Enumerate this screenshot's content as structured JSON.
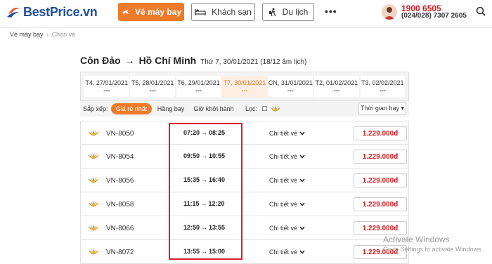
{
  "brand": {
    "name": "BestPrice",
    "suffix": ".vn"
  },
  "nav": {
    "flights_label": "Vé máy bay",
    "hotels_label": "Khách sạn",
    "travel_label": "Du lịch",
    "more_label": "•••"
  },
  "contact": {
    "hotline": "1900 6505",
    "phone": "(024/028) 7307 2605"
  },
  "breadcrumb": {
    "home": "Vé máy bay",
    "separator": "›",
    "current": "Chọn vé"
  },
  "route": {
    "from": "Côn Đảo",
    "arrow": "→",
    "to": "Hồ Chí Minh",
    "date": "Thứ 7, 30/01/2021 (18/12 âm lịch)"
  },
  "dates": [
    {
      "label": "T4, 27/01/2021",
      "price": "---"
    },
    {
      "label": "T5, 28/01/2021",
      "price": "---"
    },
    {
      "label": "T6, 29/01/2021",
      "price": "---"
    },
    {
      "label": "T7, 30/01/2021",
      "price": "---"
    },
    {
      "label": "CN, 31/01/2021",
      "price": "---"
    },
    {
      "label": "T2, 01/02/2021",
      "price": "---"
    },
    {
      "label": "T3, 02/02/2021",
      "price": "---"
    }
  ],
  "sort": {
    "label": "Sắp xếp:",
    "options": [
      "Giá rẻ nhất",
      "Hãng bay",
      "Giờ khởi hành"
    ],
    "filter_label": "Lọc:",
    "time_select": "Thời gian bay ▾"
  },
  "flights": [
    {
      "code": "VN-8050",
      "depart": "07:20",
      "arrive": "08:25",
      "detail": "Chi tiết vé",
      "price": "1.229.000đ"
    },
    {
      "code": "VN-8054",
      "depart": "09:50",
      "arrive": "10:55",
      "detail": "Chi tiết vé",
      "price": "1.229.000đ"
    },
    {
      "code": "VN-8056",
      "depart": "15:35",
      "arrive": "16:40",
      "detail": "Chi tiết vé",
      "price": "1.229.000đ"
    },
    {
      "code": "VN-8058",
      "depart": "11:15",
      "arrive": "12:20",
      "detail": "Chi tiết vé",
      "price": "1.229.000đ"
    },
    {
      "code": "VN-8066",
      "depart": "12:50",
      "arrive": "13:55",
      "detail": "Chi tiết vé",
      "price": "1.229.000đ"
    },
    {
      "code": "VN-8072",
      "depart": "13:55",
      "arrive": "15:00",
      "detail": "Chi tiết vé",
      "price": "1.229.000đ"
    }
  ],
  "watermark": {
    "title": "Activate Windows",
    "subtitle": "Go to Settings to activate Windows."
  },
  "colors": {
    "accent": "#ef7a2a",
    "price": "#d4191f",
    "brand": "#1f4f9c",
    "highlight": "#d8202a"
  },
  "icons": [
    "plane-icon",
    "hotel-icon",
    "travel-icon",
    "search-icon",
    "lotus-icon",
    "chevron-down-icon"
  ]
}
